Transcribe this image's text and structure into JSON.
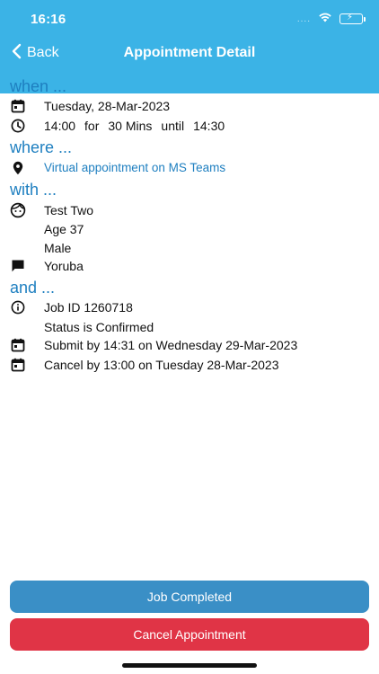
{
  "status_bar": {
    "time": "16:16",
    "signal": "....",
    "battery_color": "#4cd964"
  },
  "nav": {
    "back_label": "Back",
    "title": "Appointment Detail"
  },
  "sections": {
    "when": "when ...",
    "where": "where ...",
    "with": "with ...",
    "and": "and ..."
  },
  "when": {
    "date": "Tuesday, 28-Mar-2023",
    "start": "14:00",
    "for_word": "for",
    "duration": "30 Mins",
    "until_word": "until",
    "end": "14:30"
  },
  "where": {
    "location": "Virtual appointment on MS Teams"
  },
  "with": {
    "name": "Test Two",
    "age": "Age 37",
    "gender": "Male",
    "language": "Yoruba"
  },
  "and": {
    "job_id": "Job ID 1260718",
    "status": "Status is Confirmed",
    "submit_by": "Submit by 14:31 on Wednesday 29-Mar-2023",
    "cancel_by": "Cancel by 13:00 on Tuesday 28-Mar-2023"
  },
  "buttons": {
    "job_completed": "Job Completed",
    "cancel_appointment": "Cancel Appointment"
  },
  "colors": {
    "header": "#3bb3e6",
    "accent": "#1e7fc0",
    "primary_button": "#3a8fc6",
    "danger_button": "#e03446"
  }
}
